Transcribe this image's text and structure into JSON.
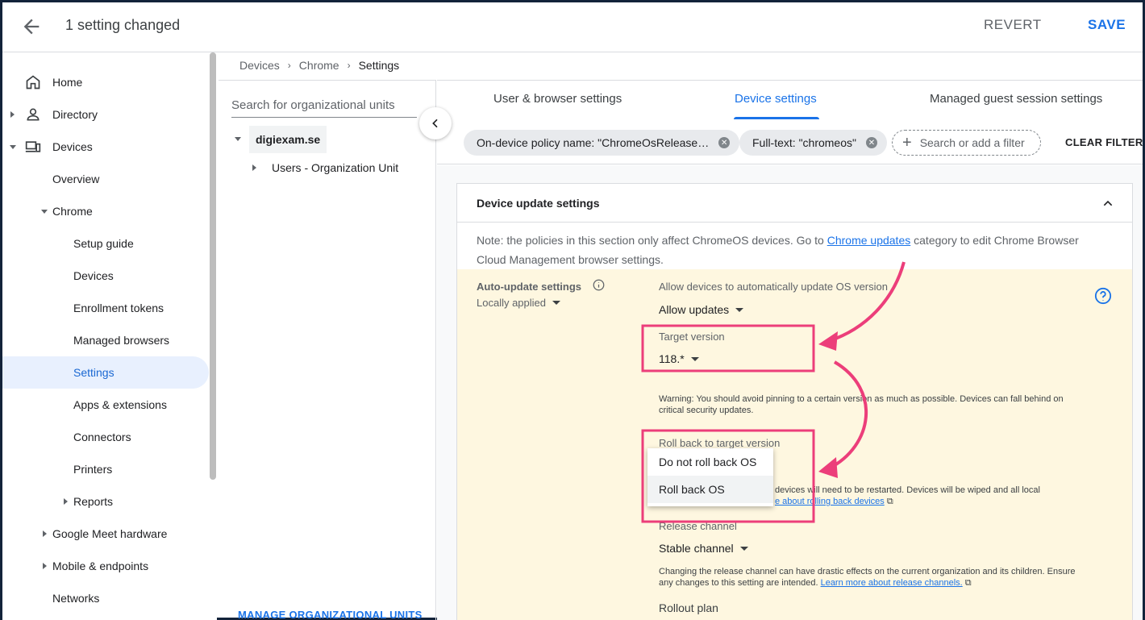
{
  "header": {
    "title": "1 setting changed",
    "revert_label": "REVERT",
    "save_label": "SAVE"
  },
  "sidebar": {
    "items": [
      {
        "label": "Home",
        "icon": "home-icon"
      },
      {
        "label": "Directory",
        "icon": "person-icon"
      },
      {
        "label": "Devices",
        "icon": "devices-icon"
      },
      {
        "label": "Overview"
      },
      {
        "label": "Chrome"
      },
      {
        "label": "Setup guide"
      },
      {
        "label": "Devices"
      },
      {
        "label": "Enrollment tokens"
      },
      {
        "label": "Managed browsers"
      },
      {
        "label": "Settings"
      },
      {
        "label": "Apps & extensions"
      },
      {
        "label": "Connectors"
      },
      {
        "label": "Printers"
      },
      {
        "label": "Reports"
      },
      {
        "label": "Google Meet hardware"
      },
      {
        "label": "Mobile & endpoints"
      },
      {
        "label": "Networks"
      }
    ]
  },
  "breadcrumb": [
    "Devices",
    "Chrome",
    "Settings"
  ],
  "org": {
    "search_placeholder": "Search for organizational units",
    "root": "digiexam.se",
    "child": "Users - Organization Unit",
    "manage_label": "MANAGE ORGANIZATIONAL UNITS"
  },
  "tabs": [
    "User & browser settings",
    "Device settings",
    "Managed guest session settings"
  ],
  "filters": {
    "chip1": "On-device policy name: \"ChromeOsRelease…",
    "chip2": "Full-text: \"chromeos\"",
    "add_placeholder": "Search or add a filter",
    "clear_label": "CLEAR FILTERS"
  },
  "card": {
    "title": "Device update settings",
    "note_pre": "Note: the policies in this section only affect ChromeOS devices. Go to ",
    "note_link": "Chrome updates",
    "note_post": " category to edit Chrome Browser Cloud Management browser settings.",
    "aus_label": "Auto-update settings",
    "locally_applied": "Locally applied",
    "allow_label": "Allow devices to automatically update OS version",
    "allow_value": "Allow updates",
    "target_label": "Target version",
    "target_value": "118.*",
    "warning": "Warning: You should avoid pinning to a certain version as much as possible. Devices can fall behind on critical security updates.",
    "rollback_label": "Roll back to target version",
    "rollback_note_pre": "devices will need to be restarted. Devices will be wiped and all local",
    "rollback_note_link": "e about rolling back devices",
    "release_label": "Release channel",
    "release_value": "Stable channel",
    "release_note_pre": "Changing the release channel can have drastic effects on the current organization and its children. Ensure any changes to this setting are intended. ",
    "release_note_link": "Learn more about release channels.",
    "rollout_label": "Rollout plan"
  },
  "rollback_options": [
    "Do not roll back OS",
    "Roll back OS"
  ],
  "colors": {
    "accent": "#1a73e8",
    "annotation": "#ec3e7a",
    "highlight_bg": "#fef7e0"
  }
}
